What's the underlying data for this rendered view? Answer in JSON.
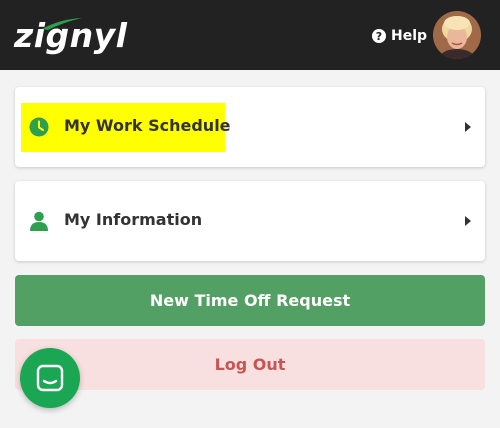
{
  "header": {
    "logo_text": "zignyl",
    "help_label": "Help",
    "help_icon": "question-circle-icon"
  },
  "menu": [
    {
      "label": "My Work Schedule",
      "icon": "clock-icon",
      "highlighted": true
    },
    {
      "label": "My Information",
      "icon": "user-icon",
      "highlighted": false
    }
  ],
  "actions": {
    "time_off_label": "New Time Off Request",
    "logout_label": "Log Out"
  },
  "colors": {
    "header_bg": "#222222",
    "accent_green": "#52a063",
    "icon_green": "#2e9e4f",
    "highlight": "#ffff00",
    "logout_bg": "#f8e0e0",
    "logout_text": "#c85552",
    "chat_bg": "#1aa653"
  }
}
